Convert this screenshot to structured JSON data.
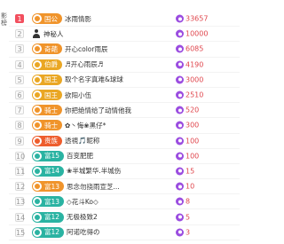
{
  "sidebar": {
    "label_chars": [
      "影",
      "榜"
    ]
  },
  "rankings": [
    {
      "rank": "1",
      "badge": "国公",
      "badge_color": "orange",
      "name": "冰雨情影",
      "score": "33657"
    },
    {
      "rank": "2",
      "badge": "",
      "badge_color": "",
      "name": "神秘人",
      "score": "10000"
    },
    {
      "rank": "3",
      "badge": "奇葩",
      "badge_color": "orange",
      "name": "开心color雨辰",
      "score": "6085"
    },
    {
      "rank": "4",
      "badge": "伯爵",
      "badge_color": "gold",
      "name": "♬开心雨辰♬",
      "score": "4190"
    },
    {
      "rank": "5",
      "badge": "国王",
      "badge_color": "gold",
      "name": "取个名字真难&球球",
      "score": "3000"
    },
    {
      "rank": "6",
      "badge": "国王",
      "badge_color": "gold",
      "name": "欲阳小伍",
      "score": "2510"
    },
    {
      "rank": "7",
      "badge": "骑士",
      "badge_color": "orange",
      "name": "你把绝情给了动情他我",
      "score": "520"
    },
    {
      "rank": "8",
      "badge": "骑士",
      "badge_color": "orange",
      "name": "✿丶悔❀黑仔*",
      "score": "300"
    },
    {
      "rank": "9",
      "badge": "贵族",
      "badge_color": "red",
      "name": "透視🎵昵称",
      "score": "100"
    },
    {
      "rank": "10",
      "badge": "富15",
      "badge_color": "green",
      "name": "百变肥肥",
      "score": "100"
    },
    {
      "rank": "11",
      "badge": "富14",
      "badge_color": "green",
      "name": "❀半城繁华.半城伤",
      "score": "15"
    },
    {
      "rank": "12",
      "badge": "富13",
      "badge_color": "orange",
      "name": "思念勿挠雨宣芝...",
      "score": "10"
    },
    {
      "rank": "13",
      "badge": "富13",
      "badge_color": "green",
      "name": "◇花斗Ko◇",
      "score": "8"
    },
    {
      "rank": "14",
      "badge": "富12",
      "badge_color": "green",
      "name": "无极极致2",
      "score": "5"
    },
    {
      "rank": "15",
      "badge": "富12",
      "badge_color": "green",
      "name": "阿诺吃得の",
      "score": "3"
    }
  ]
}
